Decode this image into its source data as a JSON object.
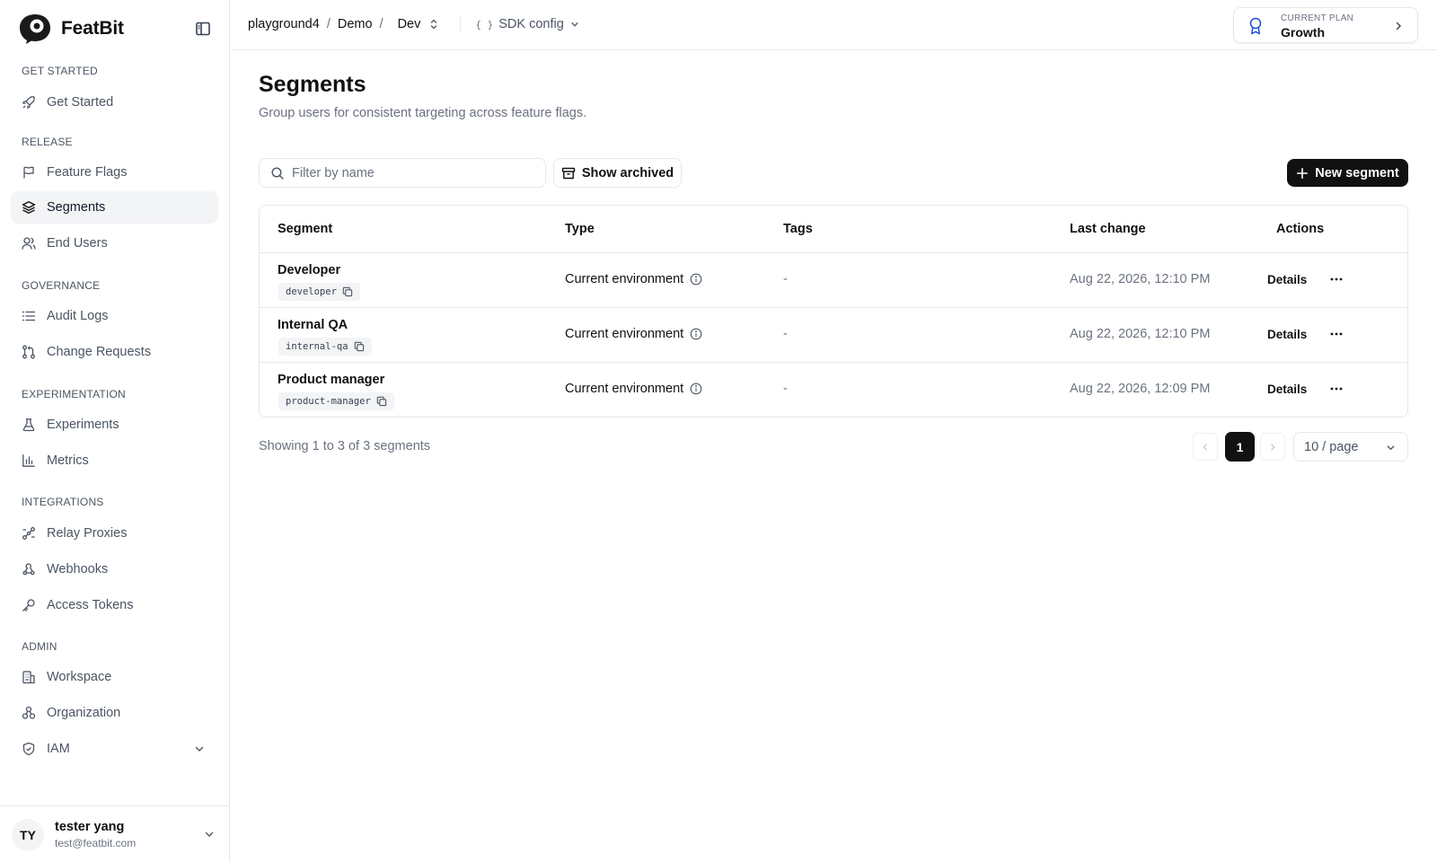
{
  "brand": {
    "name": "FeatBit"
  },
  "sidebar": {
    "sections": {
      "get_started": "GET STARTED",
      "release": "RELEASE",
      "governance": "GOVERNANCE",
      "experimentation": "EXPERIMENTATION",
      "integrations": "INTEGRATIONS",
      "admin": "ADMIN"
    },
    "items": {
      "get_started": {
        "label": "Get Started",
        "icon": "rocket-icon"
      },
      "feature_flags": {
        "label": "Feature Flags",
        "icon": "flag-icon"
      },
      "segments": {
        "label": "Segments",
        "icon": "layers-icon",
        "active": true
      },
      "end_users": {
        "label": "End Users",
        "icon": "users-icon"
      },
      "audit_logs": {
        "label": "Audit Logs",
        "icon": "list-icon"
      },
      "change_requests": {
        "label": "Change Requests",
        "icon": "git-pull-request-icon"
      },
      "experiments": {
        "label": "Experiments",
        "icon": "flask-icon"
      },
      "metrics": {
        "label": "Metrics",
        "icon": "bar-chart-icon"
      },
      "relay_proxies": {
        "label": "Relay Proxies",
        "icon": "workflow-icon"
      },
      "webhooks": {
        "label": "Webhooks",
        "icon": "webhook-icon"
      },
      "access_tokens": {
        "label": "Access Tokens",
        "icon": "key-icon"
      },
      "workspace": {
        "label": "Workspace",
        "icon": "building-icon"
      },
      "organization": {
        "label": "Organization",
        "icon": "network-icon"
      },
      "iam": {
        "label": "IAM",
        "icon": "shield-icon"
      }
    },
    "user": {
      "initials": "TY",
      "name": "tester yang",
      "email": "test@featbit.com"
    }
  },
  "topbar": {
    "breadcrumb": {
      "workspace": "playground4",
      "project": "Demo",
      "environment": "Dev"
    },
    "sdk_config": "SDK config",
    "plan": {
      "caption": "CURRENT PLAN",
      "value": "Growth"
    }
  },
  "main": {
    "title": "Segments",
    "subtitle": "Group users for consistent targeting across feature flags.",
    "search": {
      "placeholder": "Filter by name",
      "value": ""
    },
    "show_archived": "Show archived",
    "new_segment": "New segment",
    "table": {
      "headers": {
        "segment": "Segment",
        "type": "Type",
        "tags": "Tags",
        "last_change": "Last change",
        "actions": "Actions"
      },
      "rows": [
        {
          "name": "Developer",
          "key": "developer",
          "type": "Current environment",
          "tags": "-",
          "last_change": "Aug 22, 2026, 12:10 PM",
          "action": "Details"
        },
        {
          "name": "Internal QA",
          "key": "internal-qa",
          "type": "Current environment",
          "tags": "-",
          "last_change": "Aug 22, 2026, 12:10 PM",
          "action": "Details"
        },
        {
          "name": "Product manager",
          "key": "product-manager",
          "type": "Current environment",
          "tags": "-",
          "last_change": "Aug 22, 2026, 12:09 PM",
          "action": "Details"
        }
      ]
    },
    "pagination": {
      "summary": "Showing 1 to 3 of 3 segments",
      "current_page": "1",
      "per_page": "10 / page"
    }
  },
  "colors": {
    "accent": "#111111",
    "muted": "#6b7280",
    "border": "#e5e7eb",
    "active_bg": "#f3f4f6",
    "plan_icon": "#1d4ed8"
  }
}
